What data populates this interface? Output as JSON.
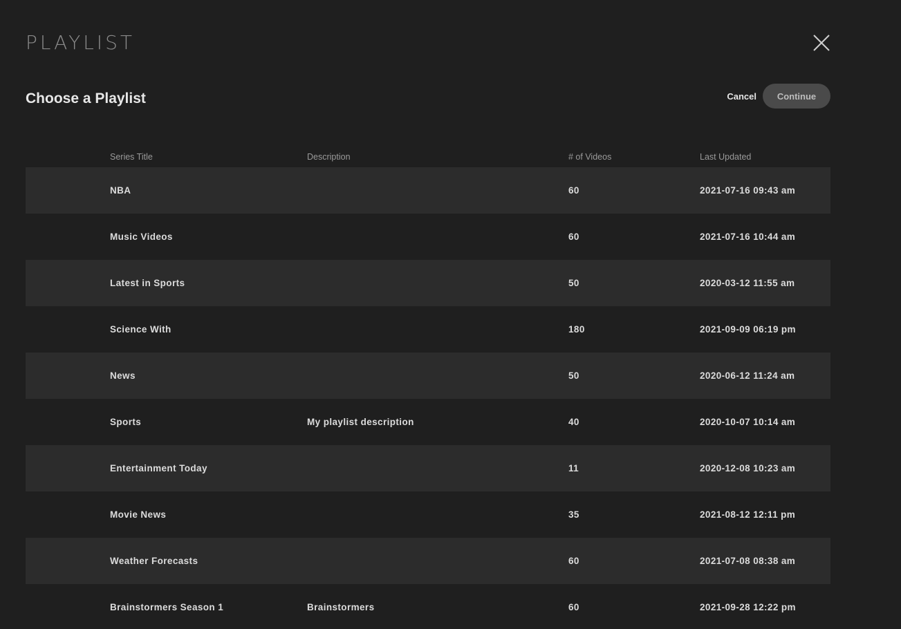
{
  "modal": {
    "title": "PLAYLIST"
  },
  "section": {
    "title": "Choose a Playlist",
    "cancel_label": "Cancel",
    "continue_label": "Continue"
  },
  "table": {
    "headers": {
      "title": "Series Title",
      "description": "Description",
      "count": "# of Videos",
      "updated": "Last Updated"
    },
    "rows": [
      {
        "title": "NBA",
        "description": "",
        "count": "60",
        "updated": "2021-07-16 09:43 am"
      },
      {
        "title": "Music Videos",
        "description": "",
        "count": "60",
        "updated": "2021-07-16 10:44 am"
      },
      {
        "title": "Latest in Sports",
        "description": "",
        "count": "50",
        "updated": "2020-03-12 11:55 am"
      },
      {
        "title": "Science With",
        "description": "",
        "count": "180",
        "updated": "2021-09-09 06:19 pm"
      },
      {
        "title": "News",
        "description": "",
        "count": "50",
        "updated": "2020-06-12 11:24 am"
      },
      {
        "title": "Sports",
        "description": "My playlist description",
        "count": "40",
        "updated": "2020-10-07 10:14 am"
      },
      {
        "title": "Entertainment Today",
        "description": "",
        "count": "11",
        "updated": "2020-12-08 10:23 am"
      },
      {
        "title": "Movie News",
        "description": "",
        "count": "35",
        "updated": "2021-08-12 12:11 pm"
      },
      {
        "title": "Weather Forecasts",
        "description": "",
        "count": "60",
        "updated": "2021-07-08 08:38 am"
      },
      {
        "title": "Brainstormers Season 1",
        "description": "Brainstormers",
        "count": "60",
        "updated": "2021-09-28 12:22 pm"
      }
    ]
  },
  "colors": {
    "background": "#1f1f1f",
    "row_alt": "#2c2c2c",
    "continue_button": "#4a4a4a"
  },
  "icons": {
    "close": "close-icon"
  }
}
